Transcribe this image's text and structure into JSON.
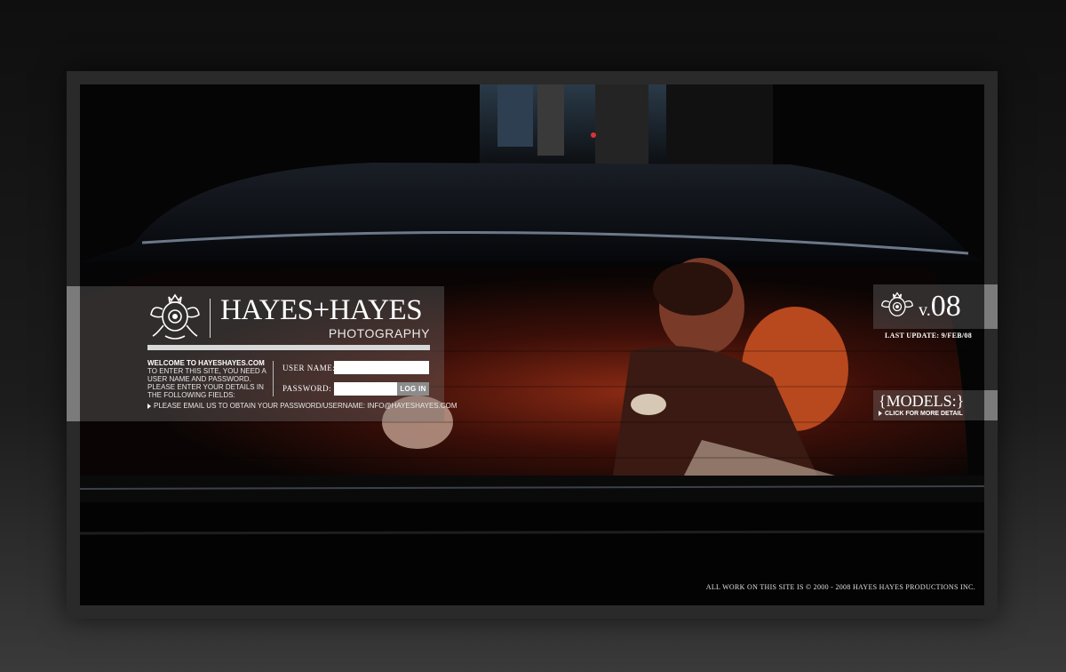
{
  "brand": {
    "title": "HAYES+HAYES",
    "subtitle": "PHOTOGRAPHY",
    "crest_icon": "crest-emblem-icon"
  },
  "login": {
    "welcome_heading": "WELCOME TO HAYESHAYES.COM",
    "welcome_body": "TO ENTER THIS SITE, YOU NEED A USER NAME AND PASSWORD. PLEASE ENTER YOUR DETAILS IN THE FOLLOWING FIELDS:",
    "username_label": "USER NAME:",
    "password_label": "PASSWORD:",
    "username_value": "",
    "password_value": "",
    "login_button": "LOG IN",
    "email_note": "PLEASE EMAIL US TO OBTAIN YOUR PASSWORD/USERNAME:  INFO@HAYESHAYES.COM"
  },
  "version": {
    "prefix": "v.",
    "number": "08",
    "last_update": "LAST UPDATE: 9/FEB/08"
  },
  "models": {
    "title": "{MODELS:}",
    "subtitle": "CLICK FOR MORE DETAIL"
  },
  "footer": {
    "copyright": "ALL WORK ON THIS SITE IS © 2000 - 2008 HAYES HAYES PRODUCTIONS INC."
  },
  "colors": {
    "panel_overlay": "#787878",
    "band": "#8a8a8a",
    "button": "#8c8c8c",
    "text": "#ffffff",
    "accent_red": "#c0301c"
  }
}
